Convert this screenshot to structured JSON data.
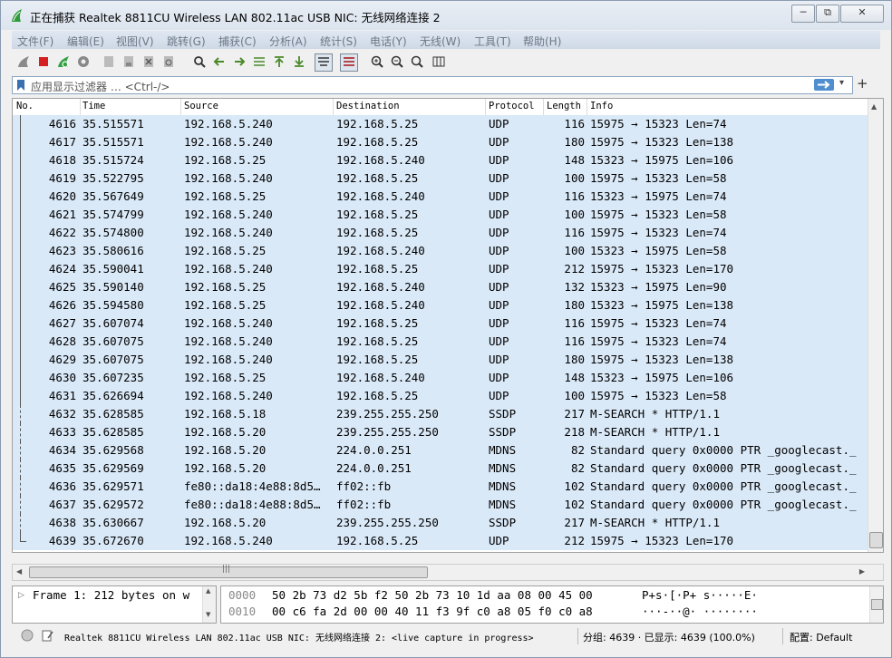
{
  "window": {
    "title": "正在捕获 Realtek 8811CU Wireless LAN 802.11ac USB NIC: 无线网络连接 2",
    "controls": {
      "minimize": "─",
      "restore": "⧉",
      "close": "✕"
    }
  },
  "menu": [
    "文件(F)",
    "编辑(E)",
    "视图(V)",
    "跳转(G)",
    "捕获(C)",
    "分析(A)",
    "统计(S)",
    "电话(Y)",
    "无线(W)",
    "工具(T)",
    "帮助(H)"
  ],
  "filter": {
    "placeholder": "应用显示过滤器 … <Ctrl-/>",
    "apply_icon": "arrow-right-icon",
    "dropdown_icon": "▾",
    "add_label": "+"
  },
  "columns": [
    "No.",
    "Time",
    "Source",
    "Destination",
    "Protocol",
    "Length",
    "Info"
  ],
  "packets": [
    [
      "4616",
      "35.515571",
      "192.168.5.240",
      "192.168.5.25",
      "UDP",
      "116",
      "15975 → 15323 Len=74"
    ],
    [
      "4617",
      "35.515571",
      "192.168.5.240",
      "192.168.5.25",
      "UDP",
      "180",
      "15975 → 15323 Len=138"
    ],
    [
      "4618",
      "35.515724",
      "192.168.5.25",
      "192.168.5.240",
      "UDP",
      "148",
      "15323 → 15975 Len=106"
    ],
    [
      "4619",
      "35.522795",
      "192.168.5.240",
      "192.168.5.25",
      "UDP",
      "100",
      "15975 → 15323 Len=58"
    ],
    [
      "4620",
      "35.567649",
      "192.168.5.25",
      "192.168.5.240",
      "UDP",
      "116",
      "15323 → 15975 Len=74"
    ],
    [
      "4621",
      "35.574799",
      "192.168.5.240",
      "192.168.5.25",
      "UDP",
      "100",
      "15975 → 15323 Len=58"
    ],
    [
      "4622",
      "35.574800",
      "192.168.5.240",
      "192.168.5.25",
      "UDP",
      "116",
      "15975 → 15323 Len=74"
    ],
    [
      "4623",
      "35.580616",
      "192.168.5.25",
      "192.168.5.240",
      "UDP",
      "100",
      "15323 → 15975 Len=58"
    ],
    [
      "4624",
      "35.590041",
      "192.168.5.240",
      "192.168.5.25",
      "UDP",
      "212",
      "15975 → 15323 Len=170"
    ],
    [
      "4625",
      "35.590140",
      "192.168.5.25",
      "192.168.5.240",
      "UDP",
      "132",
      "15323 → 15975 Len=90"
    ],
    [
      "4626",
      "35.594580",
      "192.168.5.25",
      "192.168.5.240",
      "UDP",
      "180",
      "15323 → 15975 Len=138"
    ],
    [
      "4627",
      "35.607074",
      "192.168.5.240",
      "192.168.5.25",
      "UDP",
      "116",
      "15975 → 15323 Len=74"
    ],
    [
      "4628",
      "35.607075",
      "192.168.5.240",
      "192.168.5.25",
      "UDP",
      "116",
      "15975 → 15323 Len=74"
    ],
    [
      "4629",
      "35.607075",
      "192.168.5.240",
      "192.168.5.25",
      "UDP",
      "180",
      "15975 → 15323 Len=138"
    ],
    [
      "4630",
      "35.607235",
      "192.168.5.25",
      "192.168.5.240",
      "UDP",
      "148",
      "15323 → 15975 Len=106"
    ],
    [
      "4631",
      "35.626694",
      "192.168.5.240",
      "192.168.5.25",
      "UDP",
      "100",
      "15975 → 15323 Len=58"
    ],
    [
      "4632",
      "35.628585",
      "192.168.5.18",
      "239.255.255.250",
      "SSDP",
      "217",
      "M-SEARCH * HTTP/1.1"
    ],
    [
      "4633",
      "35.628585",
      "192.168.5.20",
      "239.255.255.250",
      "SSDP",
      "218",
      "M-SEARCH * HTTP/1.1"
    ],
    [
      "4634",
      "35.629568",
      "192.168.5.20",
      "224.0.0.251",
      "MDNS",
      "82",
      "Standard query 0x0000 PTR _googlecast._"
    ],
    [
      "4635",
      "35.629569",
      "192.168.5.20",
      "224.0.0.251",
      "MDNS",
      "82",
      "Standard query 0x0000 PTR _googlecast._"
    ],
    [
      "4636",
      "35.629571",
      "fe80::da18:4e88:8d5…",
      "ff02::fb",
      "MDNS",
      "102",
      "Standard query 0x0000 PTR _googlecast._"
    ],
    [
      "4637",
      "35.629572",
      "fe80::da18:4e88:8d5…",
      "ff02::fb",
      "MDNS",
      "102",
      "Standard query 0x0000 PTR _googlecast._"
    ],
    [
      "4638",
      "35.630667",
      "192.168.5.20",
      "239.255.255.250",
      "SSDP",
      "217",
      "M-SEARCH * HTTP/1.1"
    ],
    [
      "4639",
      "35.672670",
      "192.168.5.240",
      "192.168.5.25",
      "UDP",
      "212",
      "15975 → 15323 Len=170"
    ]
  ],
  "row_color": "#dae9f8",
  "detail": {
    "text": "Frame 1: 212 bytes on w"
  },
  "bytes": [
    {
      "offset": "0000",
      "hex": "50 2b 73 d2 5b f2 50 2b  73 10 1d aa 08 00 45 00",
      "ascii": "P+s·[·P+ s·····E·"
    },
    {
      "offset": "0010",
      "hex": "00 c6 fa 2d 00 00 40 11  f3 9f c0 a8 05 f0 c0 a8",
      "ascii": "···-··@· ········"
    }
  ],
  "status": {
    "capture": "Realtek 8811CU Wireless LAN 802.11ac USB NIC: 无线网络连接 2: <live capture in progress>",
    "packets": "分组: 4639 · 已显示: 4639 (100.0%)",
    "profile": "配置: Default"
  }
}
